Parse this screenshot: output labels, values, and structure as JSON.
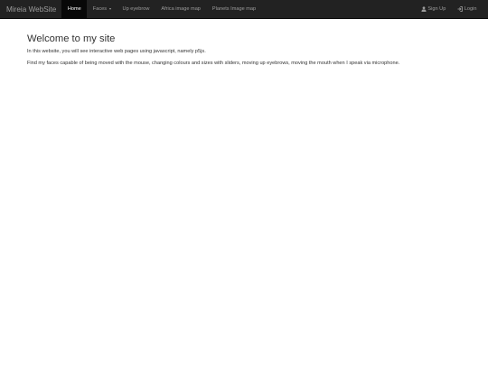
{
  "navbar": {
    "brand": "Mireia WebSite",
    "items": [
      {
        "label": "Home",
        "active": true
      },
      {
        "label": "Faces",
        "dropdown": true
      },
      {
        "label": "Up eyebrow"
      },
      {
        "label": "Africa image map"
      },
      {
        "label": "Planets Image map"
      }
    ],
    "right": [
      {
        "label": "Sign Up",
        "icon": "user-icon"
      },
      {
        "label": "Login",
        "icon": "login-icon"
      }
    ],
    "colors": {
      "background": "#222222",
      "active_background": "#080808",
      "text": "#9d9d9d",
      "active_text": "#ffffff"
    }
  },
  "main": {
    "title": "Welcome to my site",
    "paragraphs": [
      "In this website, you will see interactive web pages using javascript, namely p5js.",
      "Find my faces capable of being moved with the mouse, changing colours and sizes with sliders, moving up eyebrows, moving the mouth when I speak via microphone."
    ]
  }
}
